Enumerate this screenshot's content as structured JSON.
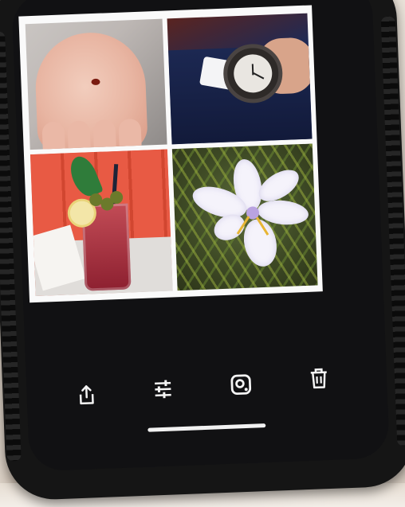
{
  "scene": {
    "description_free": true
  },
  "collage": {
    "tiles": [
      {
        "name": "hand-with-ladybug-photo"
      },
      {
        "name": "wristwatch-photo"
      },
      {
        "name": "red-drink-photo"
      },
      {
        "name": "white-flower-photo"
      }
    ]
  },
  "toolbar": {
    "buttons": [
      {
        "icon": "share-icon"
      },
      {
        "icon": "adjust-sliders-icon"
      },
      {
        "icon": "lens-scan-icon"
      },
      {
        "icon": "trash-icon"
      }
    ]
  },
  "colors": {
    "screen_bg": "#111113",
    "icon": "#f4f4f4",
    "collage_border": "#fafafa"
  }
}
